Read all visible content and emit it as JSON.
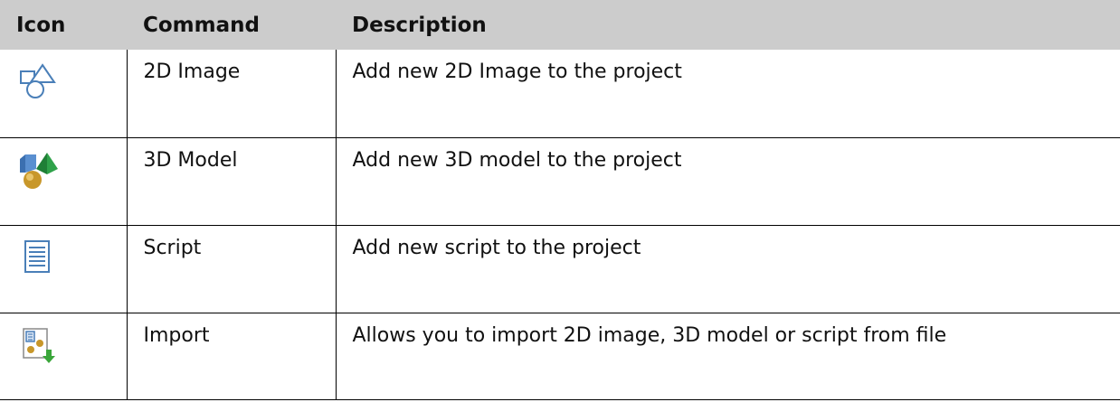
{
  "table": {
    "headers": [
      "Icon",
      "Command",
      "Description"
    ],
    "rows": [
      {
        "icon": "2d-image-shapes-icon",
        "command": "2D Image",
        "description": "Add new 2D Image to the project"
      },
      {
        "icon": "3d-model-shapes-icon",
        "command": "3D Model",
        "description": "Add new 3D model to the project"
      },
      {
        "icon": "script-document-icon",
        "command": "Script",
        "description": "Add new script to the project"
      },
      {
        "icon": "import-file-icon",
        "command": "Import",
        "description": "Allows you to import 2D image, 3D model or script from file"
      }
    ]
  },
  "colors": {
    "header_bg": "#cccccc",
    "icon_outline_blue": "#4a7fb8",
    "model_blue": "#3b6fb0",
    "model_green": "#2fa24a",
    "model_gold": "#c8972a",
    "import_arrow_green": "#3aa63a"
  }
}
